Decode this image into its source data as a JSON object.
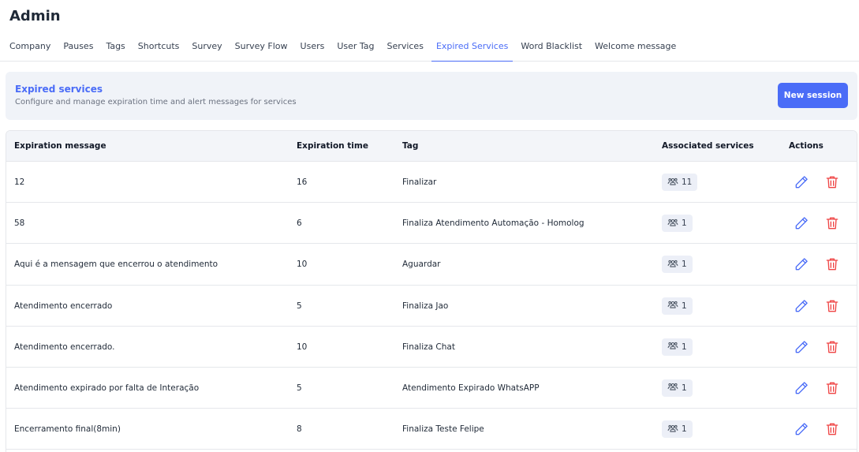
{
  "page": {
    "title": "Admin"
  },
  "tabs": [
    {
      "label": "Company",
      "active": false
    },
    {
      "label": "Pauses",
      "active": false
    },
    {
      "label": "Tags",
      "active": false
    },
    {
      "label": "Shortcuts",
      "active": false
    },
    {
      "label": "Survey",
      "active": false
    },
    {
      "label": "Survey Flow",
      "active": false
    },
    {
      "label": "Users",
      "active": false
    },
    {
      "label": "User Tag",
      "active": false
    },
    {
      "label": "Services",
      "active": false
    },
    {
      "label": "Expired Services",
      "active": true
    },
    {
      "label": "Word Blacklist",
      "active": false
    },
    {
      "label": "Welcome message",
      "active": false
    }
  ],
  "banner": {
    "title": "Expired services",
    "subtitle": "Configure and manage expiration time and alert messages for services",
    "new_button": "New session"
  },
  "table": {
    "headers": {
      "message": "Expiration message",
      "time": "Expiration time",
      "tag": "Tag",
      "services": "Associated services",
      "actions": "Actions"
    },
    "rows": [
      {
        "message": "12",
        "time": "16",
        "tag": "Finalizar",
        "services": "11"
      },
      {
        "message": "58",
        "time": "6",
        "tag": "Finaliza Atendimento Automação - Homolog",
        "services": "1"
      },
      {
        "message": "Aqui é a mensagem que encerrou o atendimento",
        "time": "10",
        "tag": "Aguardar",
        "services": "1"
      },
      {
        "message": "Atendimento encerrado",
        "time": "5",
        "tag": "Finaliza Jao",
        "services": "1"
      },
      {
        "message": "Atendimento encerrado.",
        "time": "10",
        "tag": "Finaliza Chat",
        "services": "1"
      },
      {
        "message": "Atendimento expirado por falta de Interação",
        "time": "5",
        "tag": "Atendimento Expirado WhatsAPP",
        "services": "1"
      },
      {
        "message": "Encerramento final(8min)",
        "time": "8",
        "tag": "Finaliza Teste Felipe",
        "services": "1"
      }
    ]
  },
  "icons": {
    "services_badge": "users-group-icon",
    "edit": "pencil-icon",
    "delete": "trash-icon"
  },
  "colors": {
    "accent": "#4a6cf7",
    "danger": "#ef4444",
    "banner_bg": "#f0f3f8",
    "header_bg": "#f3f5f9"
  }
}
